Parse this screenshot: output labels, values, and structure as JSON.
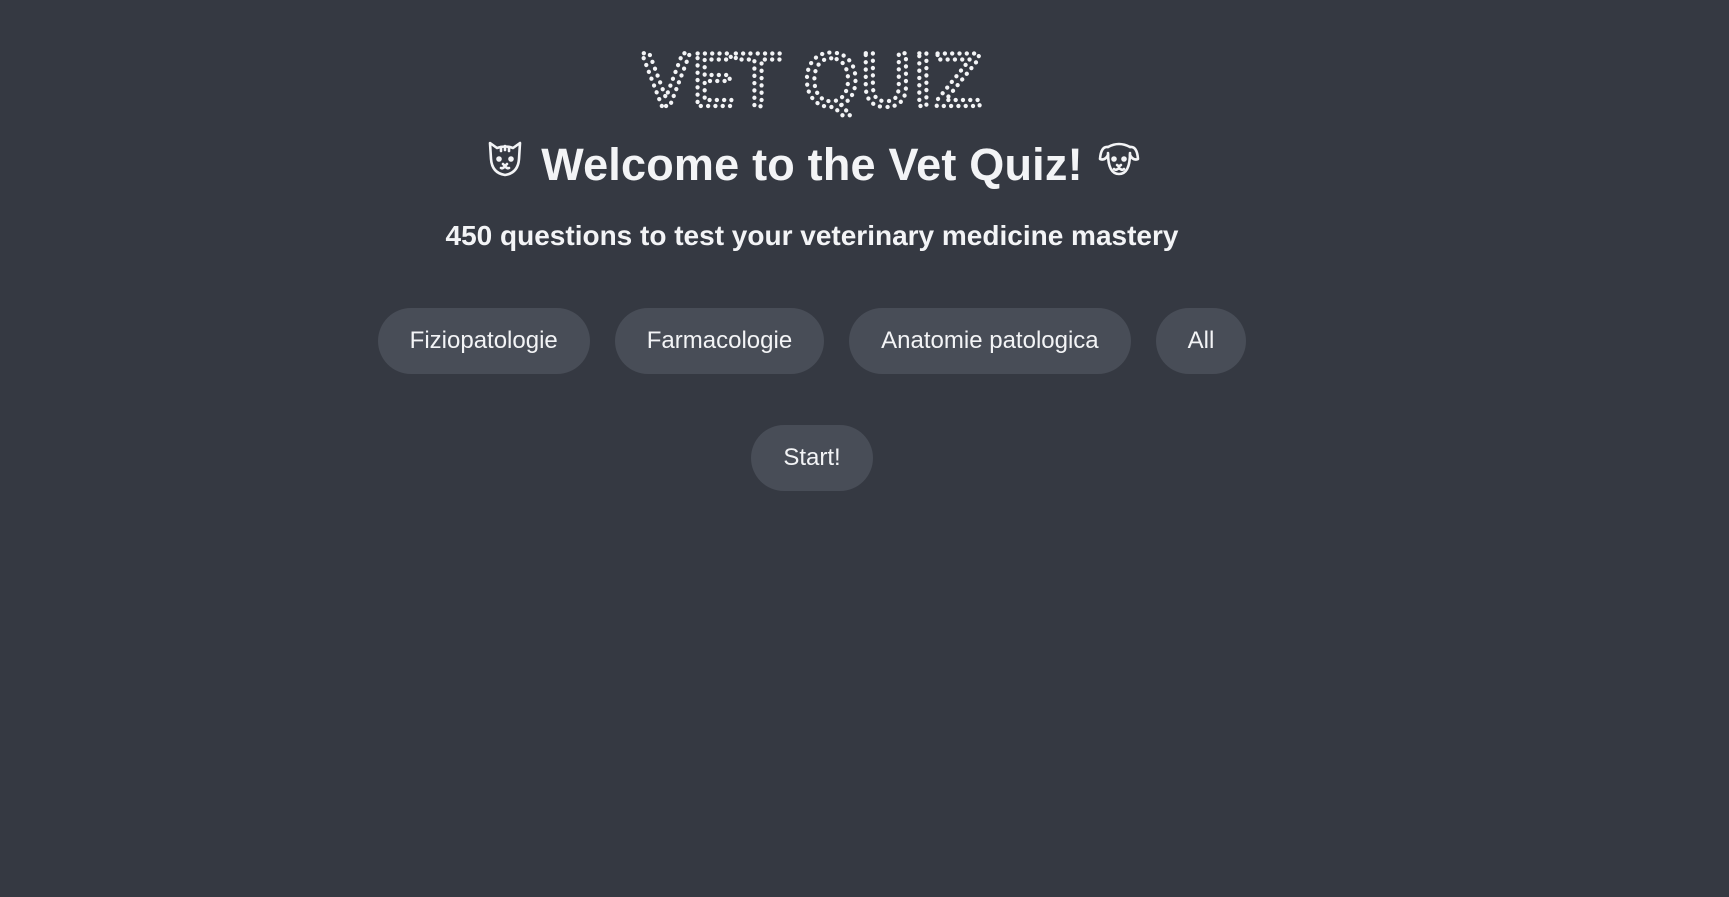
{
  "header": {
    "logo_text": "VET QUIZ",
    "welcome_title": "Welcome to the Vet Quiz!",
    "subtitle": "450 questions to test your veterinary medicine mastery",
    "left_icon": "cat-icon",
    "right_icon": "dog-icon"
  },
  "categories": {
    "items": [
      {
        "label": "Fiziopatologie"
      },
      {
        "label": "Farmacologie"
      },
      {
        "label": "Anatomie patologica"
      },
      {
        "label": "All"
      }
    ]
  },
  "actions": {
    "start_label": "Start!"
  },
  "colors": {
    "background": "#353942",
    "button": "#484d57",
    "text": "#f3f4f6"
  }
}
